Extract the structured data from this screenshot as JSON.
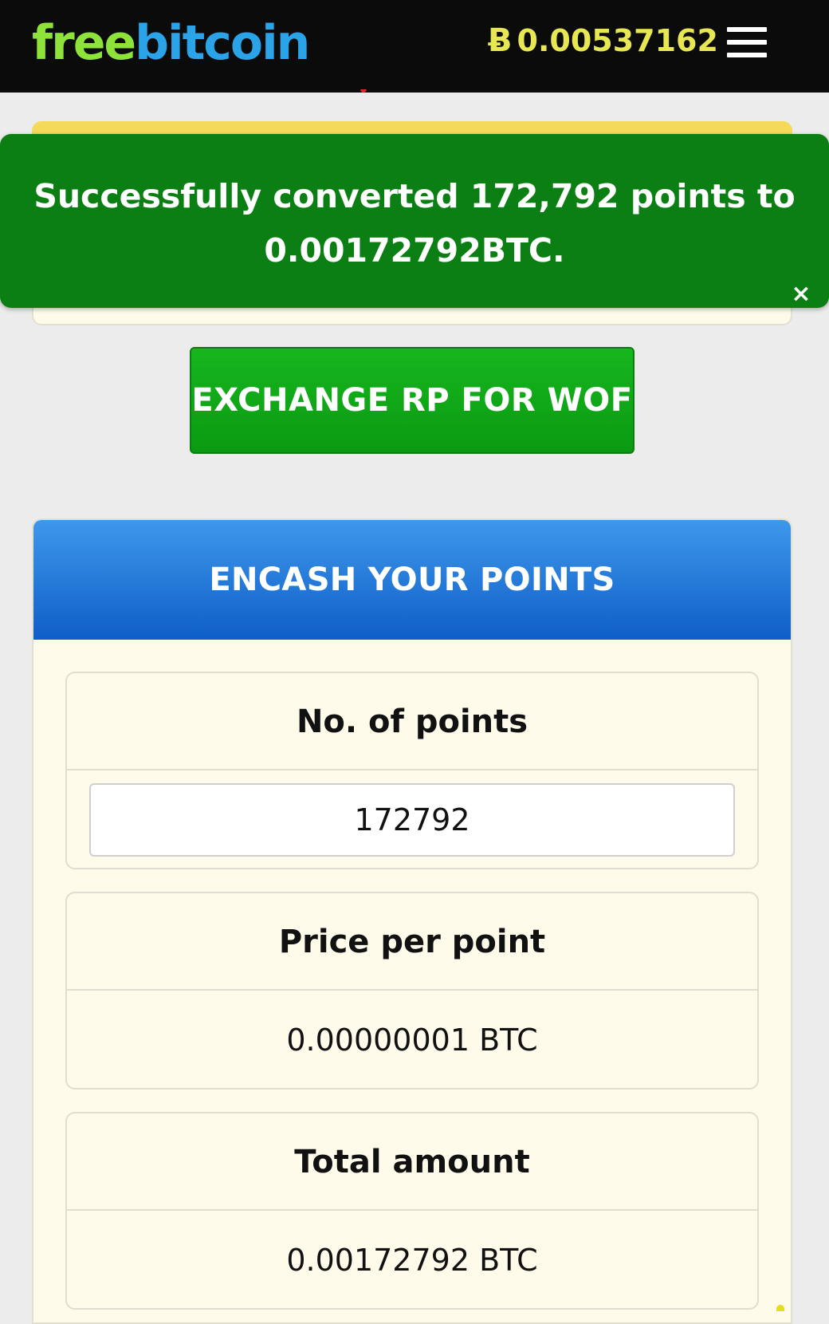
{
  "header": {
    "logo_part1": "free",
    "logo_part2": "bitcoin",
    "btc_symbol": "Ƀ",
    "balance": "0.00537162",
    "menu_icon": "hamburger-menu-icon"
  },
  "notification": {
    "line1": "Successfully converted 172,792 points to",
    "line2": "0.00172792BTC.",
    "close_symbol": "×"
  },
  "actions": {
    "exchange_label": "EXCHANGE RP FOR WOF"
  },
  "encash": {
    "title": "ENCASH YOUR POINTS",
    "points_label": "No. of points",
    "points_value": "172792",
    "price_label": "Price per point",
    "price_value": "0.00000001 BTC",
    "total_label": "Total amount",
    "total_value": "0.00172792 BTC"
  },
  "colors": {
    "topbar": "#0b0b0b",
    "logo_free": "#8ee33b",
    "logo_bitcoin": "#2aa3e8",
    "balance": "#e7e653",
    "notice_green": "#0b7f14",
    "button_green": "#0fa617",
    "header_blue": "#1f73d6",
    "panel_bg": "#fffbeb"
  }
}
